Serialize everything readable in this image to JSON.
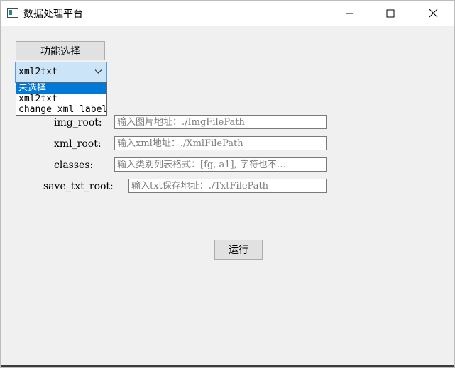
{
  "window": {
    "title": "数据处理平台"
  },
  "controls": {
    "function_button_label": "功能选择",
    "mode_selected": "xml2txt",
    "mode_options": [
      "未选择",
      "xml2txt",
      "change xml label"
    ],
    "highlighted_option_index": 0
  },
  "form": {
    "img_root": {
      "label": "img_root:",
      "placeholder": "输入图片地址：./ImgFilePath"
    },
    "xml_root": {
      "label": "xml_root:",
      "placeholder": "输入xml地址：./XmlFilePath"
    },
    "classes": {
      "label": "classes:",
      "placeholder": "输入类别列表格式：[fg, a1], 字符也不…"
    },
    "save_txt_root": {
      "label": "save_txt_root:",
      "placeholder": "输入txt保存地址：./TxtFilePath"
    }
  },
  "run_button_label": "运行",
  "icons": [
    "app-icon",
    "minimize-icon",
    "maximize-icon",
    "close-icon",
    "chevron-down-icon"
  ],
  "colors": {
    "selection": "#0078d7",
    "combo_focus_bg": "#cce4f7",
    "combo_focus_border": "#569de5"
  }
}
